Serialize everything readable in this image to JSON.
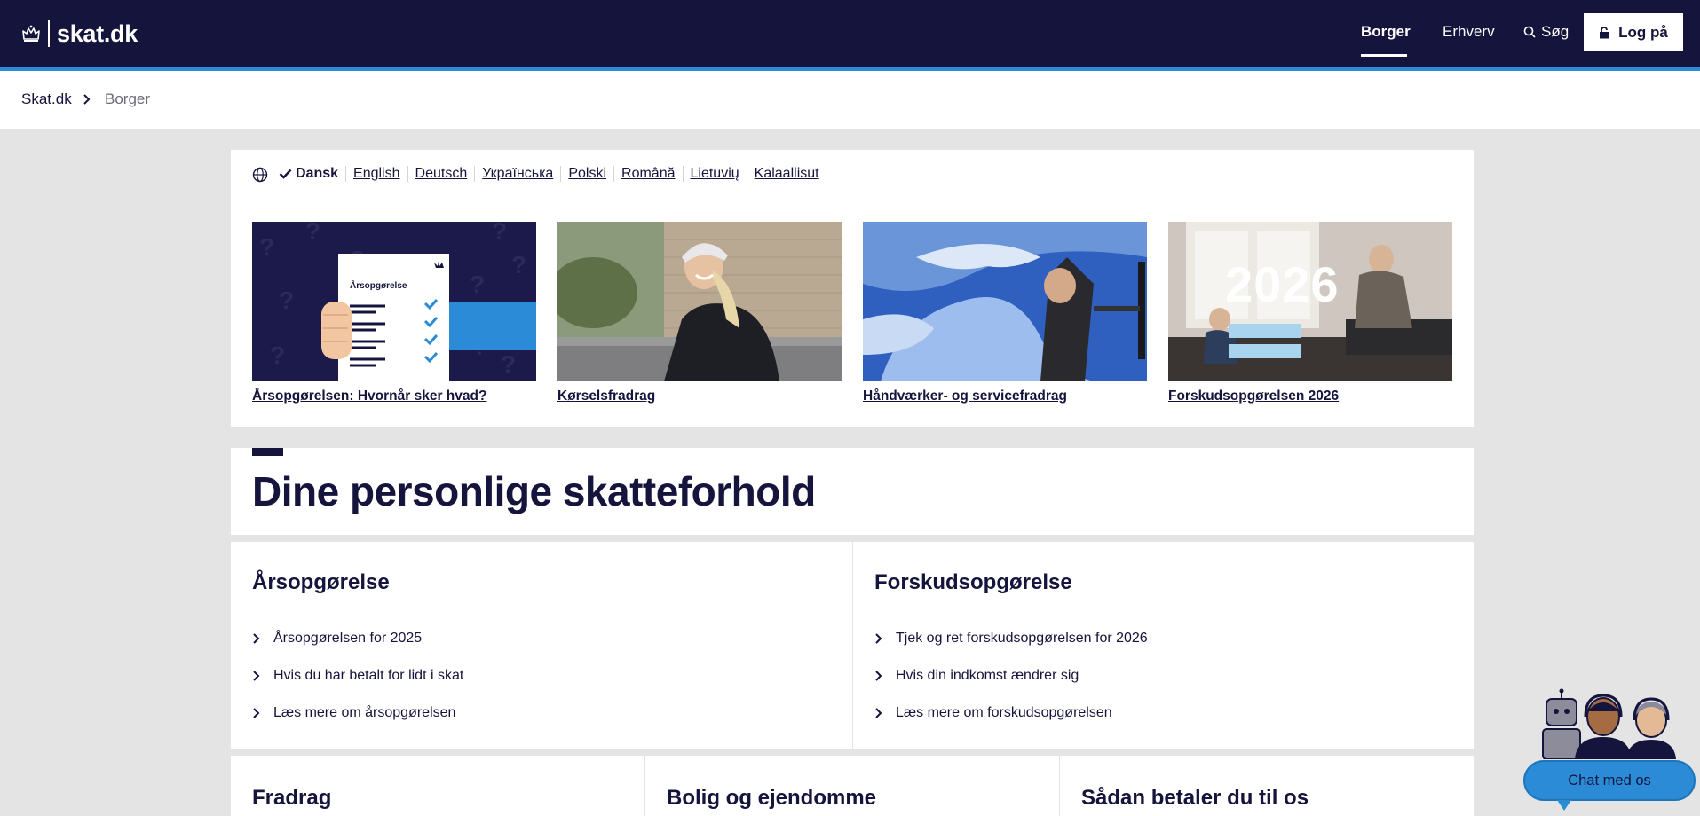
{
  "header": {
    "logo_text": "skat.dk",
    "nav": {
      "borger": "Borger",
      "erhverv": "Erhverv",
      "search": "Søg"
    },
    "login_label": "Log på"
  },
  "breadcrumb": {
    "home": "Skat.dk",
    "current": "Borger"
  },
  "languages": {
    "active": "Dansk",
    "others": [
      "English",
      "Deutsch",
      "Українська",
      "Polski",
      "Română",
      "Lietuvių",
      "Kalaallisut"
    ]
  },
  "cards": [
    {
      "title": "Årsopgørelsen: Hvornår sker hvad?",
      "image_text": "Årsopgørelse"
    },
    {
      "title": "Kørselsfradrag"
    },
    {
      "title": "Håndværker- og servicefradrag"
    },
    {
      "title": "Forskudsopgørelsen 2026",
      "image_text": "2026"
    }
  ],
  "section": {
    "title": "Dine personlige skatteforhold"
  },
  "boxes": {
    "arsopgorelse": {
      "title": "Årsopgørelse",
      "links": [
        "Årsopgørelsen for 2025",
        "Hvis du har betalt for lidt i skat",
        "Læs mere om årsopgørelsen"
      ]
    },
    "forskud": {
      "title": "Forskudsopgørelse",
      "links": [
        "Tjek og ret forskudsopgørelsen for 2026",
        "Hvis din indkomst ændrer sig",
        "Læs mere om forskudsopgørelsen"
      ]
    },
    "fradrag": {
      "title": "Fradrag"
    },
    "bolig": {
      "title": "Bolig og ejendomme"
    },
    "betaling": {
      "title": "Sådan betaler du til os"
    }
  },
  "chat": {
    "label": "Chat med os"
  },
  "colors": {
    "navy": "#14143c",
    "accent_blue": "#2b8bd6",
    "page_bg": "#e4e4e4"
  }
}
